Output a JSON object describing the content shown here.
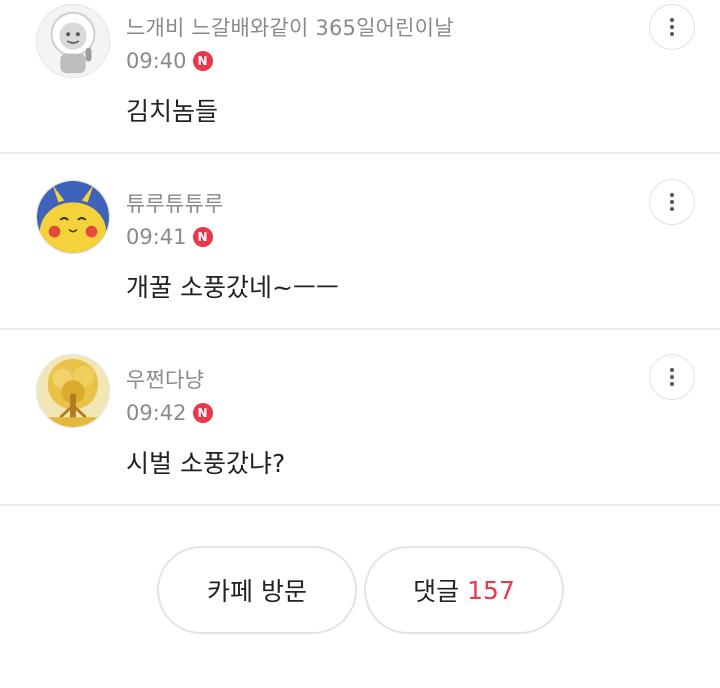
{
  "comments": [
    {
      "nickname": "느개비 느갈배와같이 365일어린이날",
      "time": "09:40",
      "badge": "N",
      "text": "김치놈들",
      "avatar": "sticker-character-avatar"
    },
    {
      "nickname": "튜루튜튜루",
      "time": "09:41",
      "badge": "N",
      "text": "개꿀 소풍갔네~ㅡㅡ",
      "avatar": "yellow-mascot-avatar"
    },
    {
      "nickname": "우쩐다냥",
      "time": "09:42",
      "badge": "N",
      "text": "시벌 소풍갔냐?",
      "avatar": "golden-tree-avatar"
    }
  ],
  "footer": {
    "visit_cafe_label": "카페 방문",
    "comments_label": "댓글",
    "comments_count": "157"
  },
  "colors": {
    "accent": "#e8384a",
    "meta_text": "#8a8a8a",
    "body_text": "#222222",
    "divider": "#ececec"
  }
}
